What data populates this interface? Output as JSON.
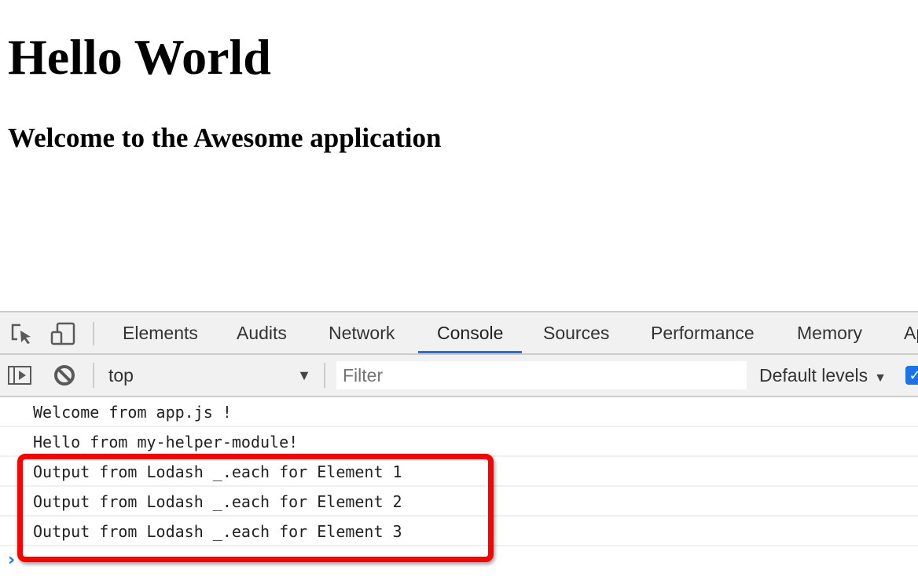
{
  "page": {
    "heading": "Hello World",
    "subheading": "Welcome to the Awesome application"
  },
  "devtools": {
    "toolbar_icons": [
      "inspect-element-icon",
      "device-toolbar-icon"
    ],
    "tabs": [
      {
        "label": "Elements",
        "active": false
      },
      {
        "label": "Audits",
        "active": false
      },
      {
        "label": "Network",
        "active": false
      },
      {
        "label": "Console",
        "active": true
      },
      {
        "label": "Sources",
        "active": false
      },
      {
        "label": "Performance",
        "active": false
      },
      {
        "label": "Memory",
        "active": false
      },
      {
        "label": "Application",
        "active": false
      }
    ],
    "console_toolbar": {
      "sidebar_icon": "show-console-sidebar-icon",
      "clear_icon": "clear-console-icon",
      "context": "top",
      "filter_placeholder": "Filter",
      "filter_value": "",
      "levels": "Default levels",
      "checkbox_checked": true
    },
    "messages": [
      "Welcome from app.js !",
      "Hello from my-helper-module!",
      "Output from Lodash _.each for Element 1",
      "Output from Lodash _.each for Element 2",
      "Output from Lodash _.each for Element 3"
    ],
    "prompt_symbol": "›",
    "accent_color": "#1a73e8",
    "highlight_color": "#ff0000"
  }
}
